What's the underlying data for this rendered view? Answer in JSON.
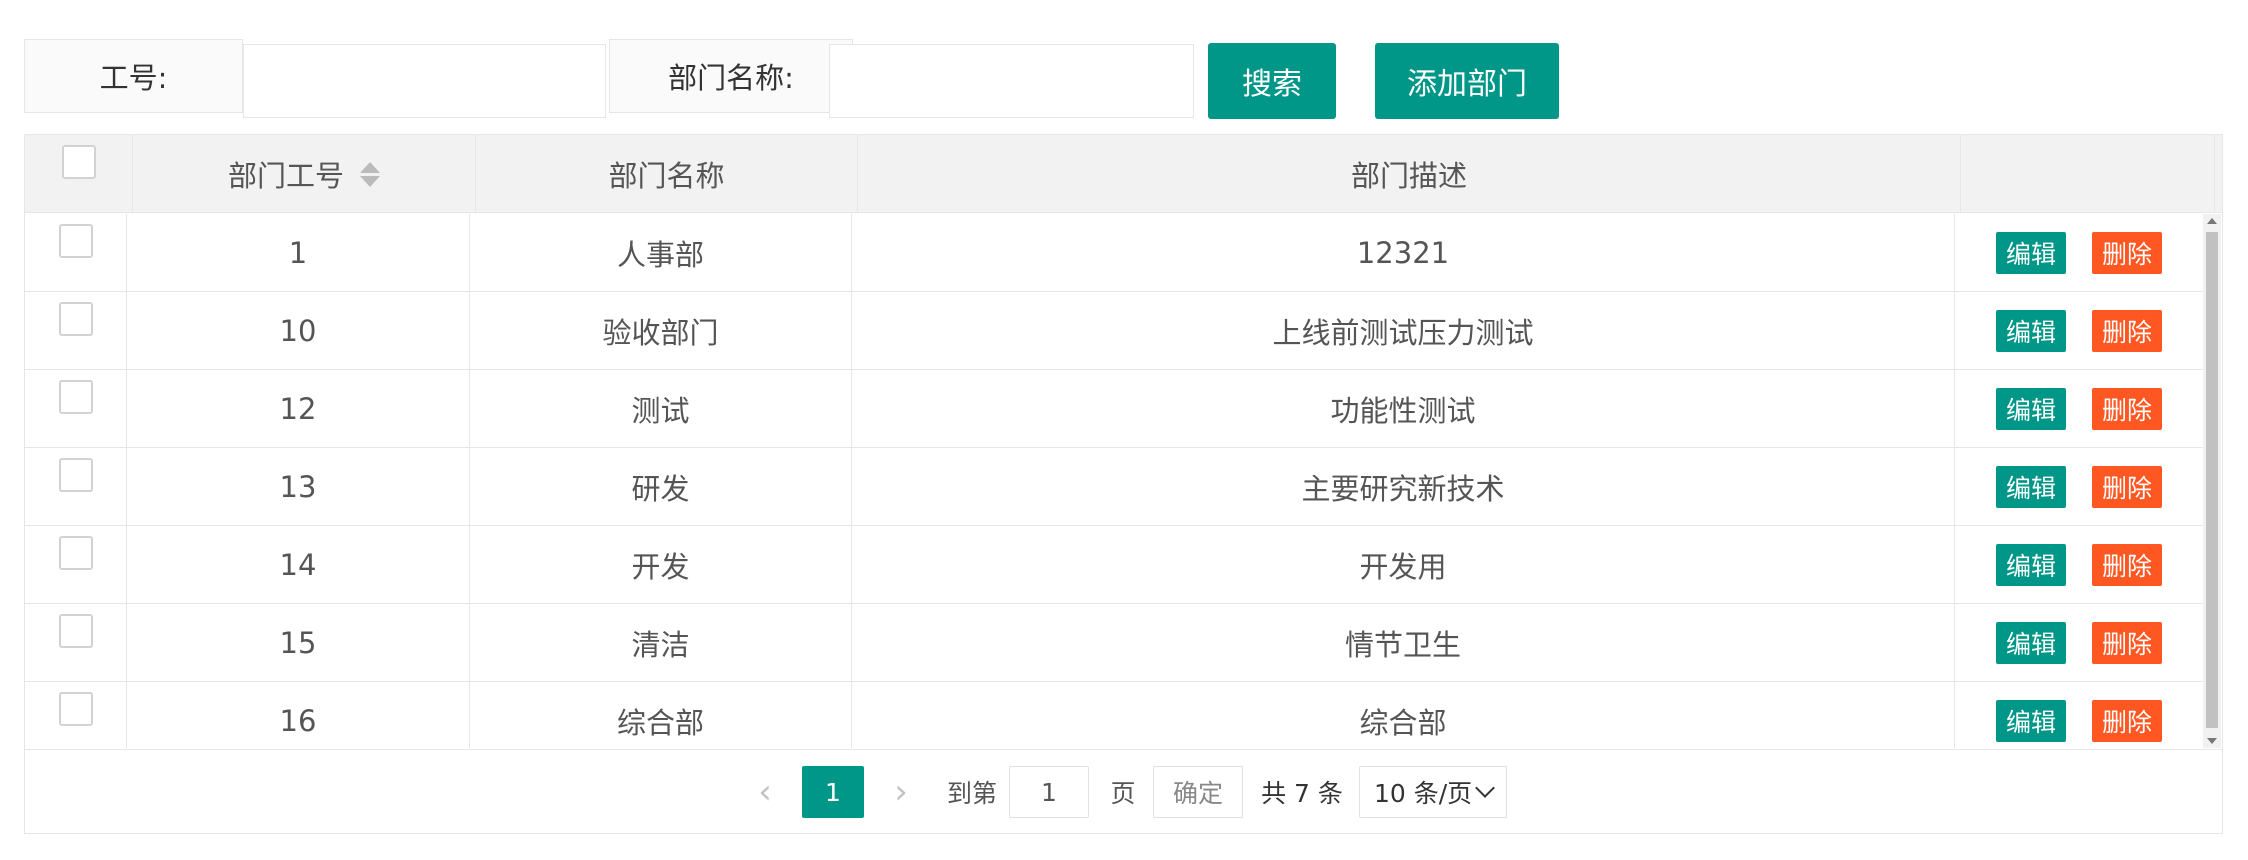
{
  "search": {
    "emp_no_label": "工号:",
    "emp_no_value": "",
    "dept_name_label": "部门名称:",
    "dept_name_value": "",
    "search_button": "搜索",
    "add_button": "添加部门"
  },
  "table": {
    "headers": {
      "dept_no": "部门工号",
      "dept_name": "部门名称",
      "dept_desc": "部门描述",
      "actions": ""
    },
    "edit_label": "编辑",
    "delete_label": "删除",
    "rows": [
      {
        "no": "1",
        "name": "人事部",
        "desc": "12321"
      },
      {
        "no": "10",
        "name": "验收部门",
        "desc": "上线前测试压力测试"
      },
      {
        "no": "12",
        "name": "测试",
        "desc": "功能性测试"
      },
      {
        "no": "13",
        "name": "研发",
        "desc": "主要研究新技术"
      },
      {
        "no": "14",
        "name": "开发",
        "desc": "开发用"
      },
      {
        "no": "15",
        "name": "清洁",
        "desc": "情节卫生"
      },
      {
        "no": "16",
        "name": "综合部",
        "desc": "综合部"
      }
    ]
  },
  "pagination": {
    "prev": "‹",
    "current_page": "1",
    "next": "›",
    "goto_label": "到第",
    "goto_value": "1",
    "page_unit": "页",
    "confirm": "确定",
    "total": "共 7 条",
    "page_size": "10 条/页"
  },
  "colors": {
    "primary": "#009688",
    "danger": "#ff5722"
  }
}
